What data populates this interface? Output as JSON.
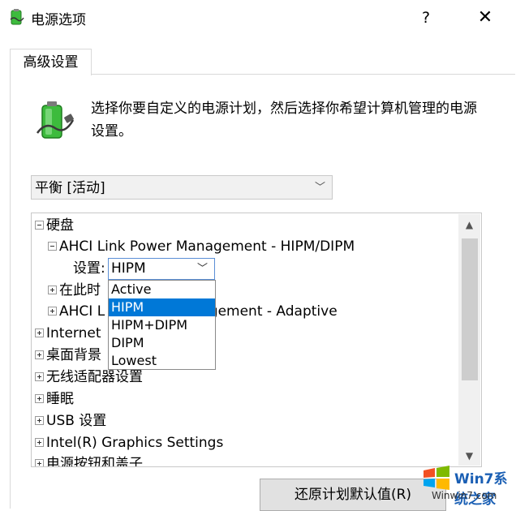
{
  "window": {
    "title": "电源选项",
    "help_label": "?",
    "close_label": "✕"
  },
  "tabs": [
    {
      "label": "高级设置",
      "active": true
    }
  ],
  "description": "选择你要自定义的电源计划，然后选择你希望计算机管理的电源设置。",
  "plan_select": {
    "value": "平衡 [活动]"
  },
  "tree": {
    "items": [
      {
        "label": "硬盘",
        "expander": "minus"
      },
      {
        "label": "AHCI Link Power Management - HIPM/DIPM",
        "expander": "minus"
      },
      {
        "label": "在此时",
        "expander": "plus"
      },
      {
        "label": "AHCI L",
        "label_tail": "anagement - Adaptive",
        "expander": "plus"
      },
      {
        "label": "Internet",
        "expander": "plus"
      },
      {
        "label": "桌面背景",
        "expander": "plus"
      },
      {
        "label": "无线适配器设置",
        "expander": "plus"
      },
      {
        "label": "睡眠",
        "expander": "plus"
      },
      {
        "label": "USB 设置",
        "expander": "plus"
      },
      {
        "label": "Intel(R) Graphics Settings",
        "expander": "plus"
      },
      {
        "label": "电源按钮和盖子",
        "expander": "plus"
      }
    ],
    "setting_label": "设置:",
    "setting_value": "HIPM",
    "options": [
      "Active",
      "HIPM",
      "HIPM+DIPM",
      "DIPM",
      "Lowest"
    ],
    "selected_option": "HIPM"
  },
  "buttons": {
    "restore_label": "还原计划默认值(R)"
  },
  "watermark": {
    "text": "Win7系统之家",
    "url": "Winwin7.com"
  },
  "colors": {
    "accent": "#0078d7",
    "battery_green": "#3dbb3d"
  }
}
